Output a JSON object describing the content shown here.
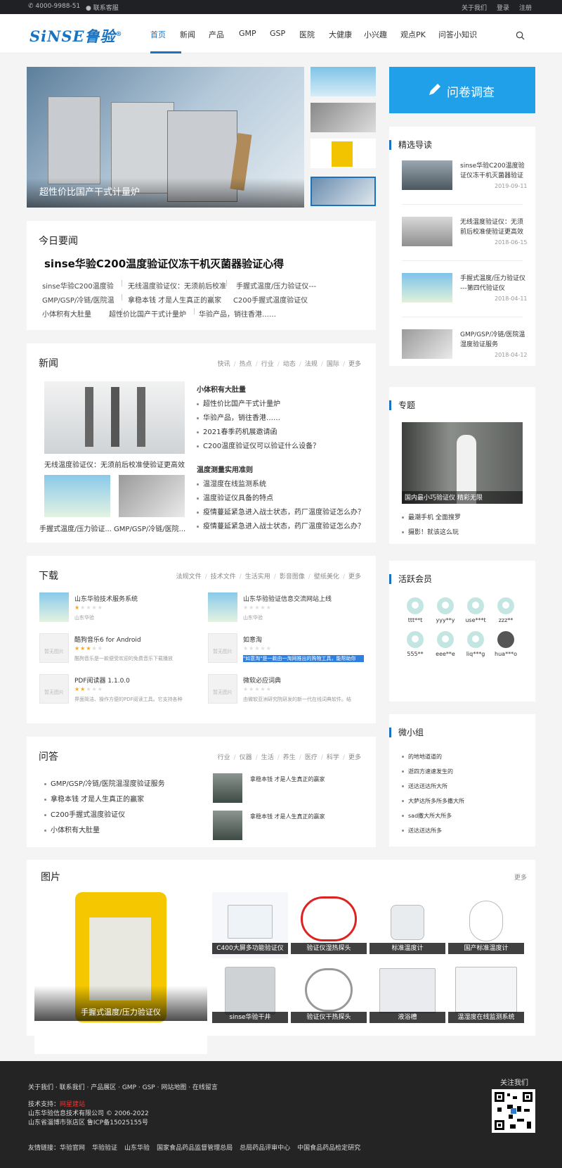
{
  "topbar": {
    "phone": "4000-9988-51",
    "service": "联系客服",
    "about": "关于我们",
    "login": "登录",
    "register": "注册"
  },
  "logo": {
    "text": "SiNSE鲁验",
    "mark": "®"
  },
  "nav": [
    "首页",
    "新闻",
    "产品",
    "GMP",
    "GSP",
    "医院",
    "大健康",
    "小兴趣",
    "观点PK",
    "问答小知识"
  ],
  "hero": {
    "caption": "超性价比国产干式计量炉"
  },
  "survey": {
    "label": "问卷调查"
  },
  "today": {
    "title": "今日要闻",
    "headline": "sinse华验C200温度验证仪冻干机灭菌器验证心得",
    "links": [
      [
        "sinse华验C200温度验",
        "无线温度验证仪：无须前后校准",
        "手握式温度/压力验证仪---"
      ],
      [
        "GMP/GSP/冷链/医院温",
        "拿稳本钱 才是人生真正的赢家",
        "C200手握式温度验证仪"
      ],
      [
        "小体积有大肚量",
        "超性价比国产干式计量炉",
        "华验产品，销往香港……"
      ]
    ]
  },
  "news": {
    "title": "新闻",
    "tabs": [
      "快讯",
      "热点",
      "行业",
      "动态",
      "法规",
      "国际",
      "更多"
    ],
    "main_caption": "无线温度验证仪：无须前后校准使验证更高效",
    "thumbs": [
      "手握式温度/压力验证...",
      "GMP/GSP/冷链/医院..."
    ],
    "group1_title": "小体积有大肚量",
    "group1": [
      "超性价比国产干式计量炉",
      "华验产品，销往香港……",
      "2021春季药机展邀请函",
      "C200温度验证仪可以验证什么设备？"
    ],
    "group2_title": "温度测量实用准则",
    "group2": [
      "温湿度在线监测系统",
      "温度验证仪具备的特点",
      "疫情蔓延紧急进入战士状态，药厂温度验证怎么办？",
      "疫情蔓延紧急进入战士状态，药厂温度验证怎么办？"
    ]
  },
  "download": {
    "title": "下载",
    "tabs": [
      "法规文件",
      "技术文件",
      "生活实用",
      "影音图像",
      "壁纸美化",
      "更多"
    ],
    "items": [
      {
        "name": "山东华验技术服务系统",
        "desc": "山东华验",
        "stars": 1,
        "noimg": false
      },
      {
        "name": "山东华验验证信息交流网站上线",
        "desc": "山东华验",
        "stars": 0,
        "noimg": false
      },
      {
        "name": "酷狗音乐6 for Android",
        "desc": "酷狗音乐是一款便受欢迎的免费音乐下载播放",
        "stars": 3,
        "noimg": true
      },
      {
        "name": "如意淘",
        "desc": "\"如意淘\"是一款由一淘网推出的购物工具，能帮助你",
        "stars": 0,
        "noimg": true,
        "hl": true
      },
      {
        "name": "PDF阅读器 1.1.0.0",
        "desc": "界面简洁、操作方便的PDF阅读工具。它支持各种",
        "stars": 2,
        "noimg": true
      },
      {
        "name": "微软必应词典",
        "desc": "由微软亚洲研究院研发的新一代在线词典软件。结",
        "stars": 0,
        "noimg": true
      }
    ],
    "noimg_label": "暂无图片"
  },
  "qa": {
    "title": "问答",
    "tabs": [
      "行业",
      "仪器",
      "生活",
      "养生",
      "医疗",
      "科学",
      "更多"
    ],
    "list": [
      "GMP/GSP/冷链/医院温湿度验证服务",
      "拿稳本钱 才是人生真正的赢家",
      "C200手握式温度验证仪",
      "小体积有大肚量"
    ],
    "right": [
      "拿稳本钱 才是人生真正的赢家",
      "拿稳本钱 才是人生真正的赢家"
    ]
  },
  "featured": {
    "title": "精选导读",
    "items": [
      {
        "t1": "sinse华验C200温度验",
        "t2": "证仪冻干机灭菌器验证",
        "date": "2019-09-11"
      },
      {
        "t1": "无线温度验证仪：无须",
        "t2": "前后校准使验证更高效",
        "date": "2018-06-15"
      },
      {
        "t1": "手握式温度/压力验证仪",
        "t2": "---第四代验证仪",
        "date": "2018-04-11"
      },
      {
        "t1": "GMP/GSP/冷链/医院温",
        "t2": "湿度验证服务",
        "date": "2018-04-12"
      }
    ]
  },
  "topic": {
    "title": "专题",
    "caption": "国内最小巧验证仪 精彩无限",
    "links": [
      "最潮手机 全面搜罗",
      "摄影！就该这么玩"
    ]
  },
  "members": {
    "title": "活跃会员",
    "names": [
      "ttt**t",
      "yyy**y",
      "use***t",
      "zzz**",
      "555**",
      "eee**e",
      "liq***g",
      "hua***o"
    ]
  },
  "groups": {
    "title": "微小组",
    "items": [
      "的地地道道的",
      "逝四方速速发生的",
      "送达送达所大所",
      "大萨达所多所多撒大所",
      "sad撒大所大所多",
      "送达送达所多"
    ]
  },
  "gallery": {
    "title": "图片",
    "more": "更多",
    "big_caption": "手握式温度/压力验证仪",
    "captions": [
      "C400大屏多功能验证仪",
      "验证仪湿热探头",
      "标准温度计",
      "国产标准温度计",
      "sinse华验干井",
      "验证仪干热探头",
      "液浴槽",
      "温湿度在线监测系统"
    ]
  },
  "footer": {
    "links": [
      "关于我们",
      "联系我们",
      "产品展区",
      "GMP",
      "GSP",
      "网站地图",
      "在线留言"
    ],
    "tech_label": "技术支持：",
    "tech_name": "网星建站",
    "copyright": "山东华验信息技术有限公司 © 2006-2022",
    "address": "山东省淄博市张店区 鲁ICP备15025155号",
    "friend_label": "友情链接：",
    "friends": [
      "华验官网",
      "华验验证",
      "山东华验",
      "国家食品药品监督管理总局",
      "总局药品评审中心",
      "中国食品药品检定研究"
    ],
    "follow": "关注我们"
  },
  "colors": {
    "brand": "#1a73c0",
    "survey": "#1fa0e8",
    "dark": "#242424"
  }
}
